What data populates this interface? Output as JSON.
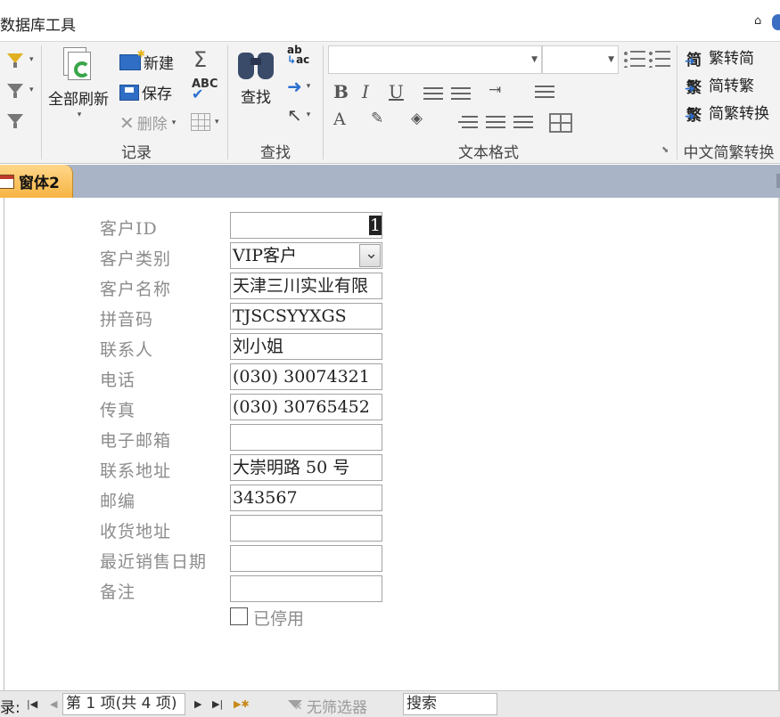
{
  "ribbon_tab_title": "数据库工具",
  "ribbon": {
    "records": {
      "group_label": "记录",
      "refresh_all": "全部刷新",
      "new": "新建",
      "save": "保存",
      "delete": "删除"
    },
    "find": {
      "group_label": "查找",
      "find": "查找"
    },
    "text_format": {
      "group_label": "文本格式"
    },
    "chinese_conversion": {
      "group_label": "中文简繁转换",
      "to_simplified": "繁转简",
      "to_traditional": "简转繁",
      "convert": "简繁转换"
    }
  },
  "document_tab": {
    "title": "窗体2"
  },
  "form": {
    "fields": [
      {
        "label": "客户ID",
        "value": "1"
      },
      {
        "label": "客户类别",
        "value": "VIP客户"
      },
      {
        "label": "客户名称",
        "value": "天津三川实业有限"
      },
      {
        "label": "拼音码",
        "value": "TJSCSYYXGS"
      },
      {
        "label": "联系人",
        "value": "刘小姐"
      },
      {
        "label": "电话",
        "value": "(030) 30074321"
      },
      {
        "label": "传真",
        "value": "(030) 30765452"
      },
      {
        "label": "电子邮箱",
        "value": ""
      },
      {
        "label": "联系地址",
        "value": "大崇明路 50 号"
      },
      {
        "label": "邮编",
        "value": "343567"
      },
      {
        "label": "收货地址",
        "value": ""
      },
      {
        "label": "最近销售日期",
        "value": ""
      },
      {
        "label": "备注",
        "value": ""
      }
    ],
    "disabled_checkbox_label": "已停用"
  },
  "navigation": {
    "record_label": "录:",
    "position": "第 1 项(共 4 项)",
    "filter_status": "无筛选器",
    "search_placeholder": "搜索"
  },
  "colors": {
    "ribbon_bg": "#f3f3f3",
    "tab_accent": "#f6b443",
    "tabbar_bg": "#a9b4c6"
  }
}
